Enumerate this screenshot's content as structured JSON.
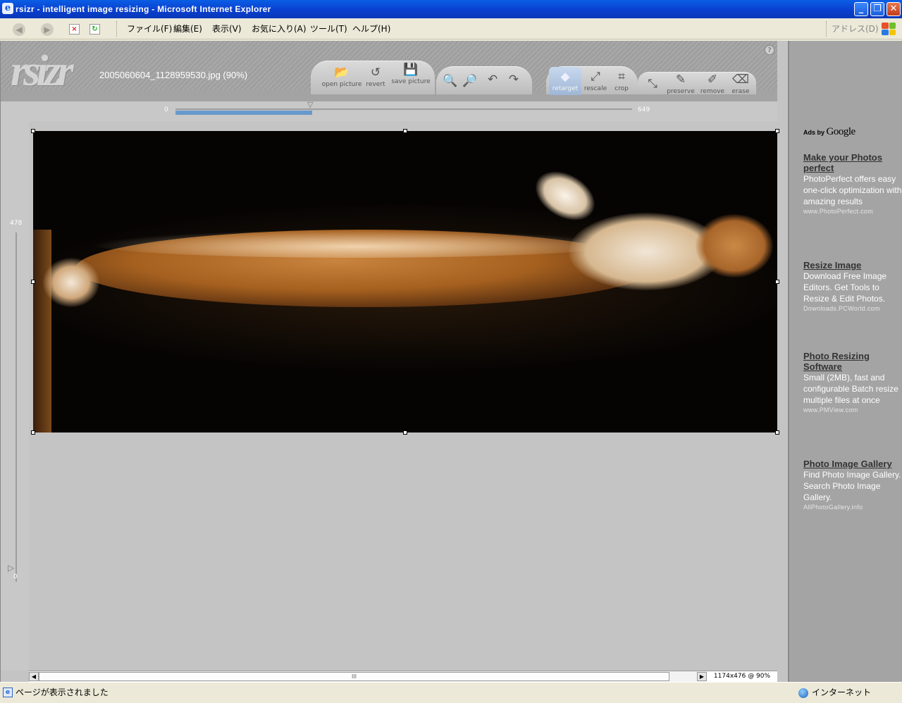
{
  "window": {
    "title": "rsizr - intelligent image resizing - Microsoft Internet Explorer",
    "controls": {
      "minimize": "_",
      "restore": "❐",
      "close": "✕"
    }
  },
  "ie_toolbar": {
    "menus": [
      "ファイル(F)",
      "編集(E)",
      "表示(V)",
      "お気に入り(A)",
      "ツール(T)",
      "ヘルプ(H)"
    ],
    "address_label": "アドレス(D)"
  },
  "app": {
    "logo_text": "rsizr",
    "filename": "2005060604_1128959530.jpg (90%)",
    "buttons": {
      "open": "open picture",
      "revert": "revert",
      "save": "save picture",
      "retarget": "retarget",
      "rescale": "rescale",
      "crop": "crop",
      "preserve": "preserve",
      "remove": "remove",
      "erase": "erase"
    },
    "icons": {
      "open": "📂",
      "revert": "↺",
      "save": "💾",
      "zoom_in": "🔍",
      "zoom_out": "🔎",
      "rotate_left": "↶",
      "rotate_right": "↷",
      "retarget": "◆",
      "rescale": "⤢",
      "crop": "⌗",
      "expand": "⤡",
      "preserve": "✎",
      "remove": "✐",
      "erase": "⌫",
      "help": "?"
    },
    "width_slider": {
      "min": "0",
      "max": "649",
      "value_fraction": 0.3
    },
    "height_slider": {
      "max": "478",
      "min": "0",
      "value_fraction": 0.0
    },
    "status_dims": "1174x476 @ 90%",
    "scroll_grip": "III"
  },
  "ads": {
    "header_prefix": "Ads by",
    "header_brand": "Google",
    "items": [
      {
        "title": "Make your Photos perfect",
        "body": "PhotoPerfect offers easy one-click optimization with amazing results",
        "url": "www.PhotoPerfect.com"
      },
      {
        "title": "Resize Image",
        "body": "Download Free Image Editors. Get Tools to Resize & Edit Photos.",
        "url": "Downloads.PCWorld.com"
      },
      {
        "title": "Photo Resizing Software",
        "body": "Small (2MB), fast and configurable Batch resize multiple files at once",
        "url": "www.PMView.com"
      },
      {
        "title": "Photo Image Gallery",
        "body": "Find Photo Image Gallery. Search Photo Image Gallery.",
        "url": "AllPhotoGallery.info"
      }
    ]
  },
  "statusbar": {
    "text": "ページが表示されました",
    "zone": "インターネット"
  },
  "colors": {
    "accent": "#6699cc",
    "xp_title": "#0a3fcf"
  }
}
